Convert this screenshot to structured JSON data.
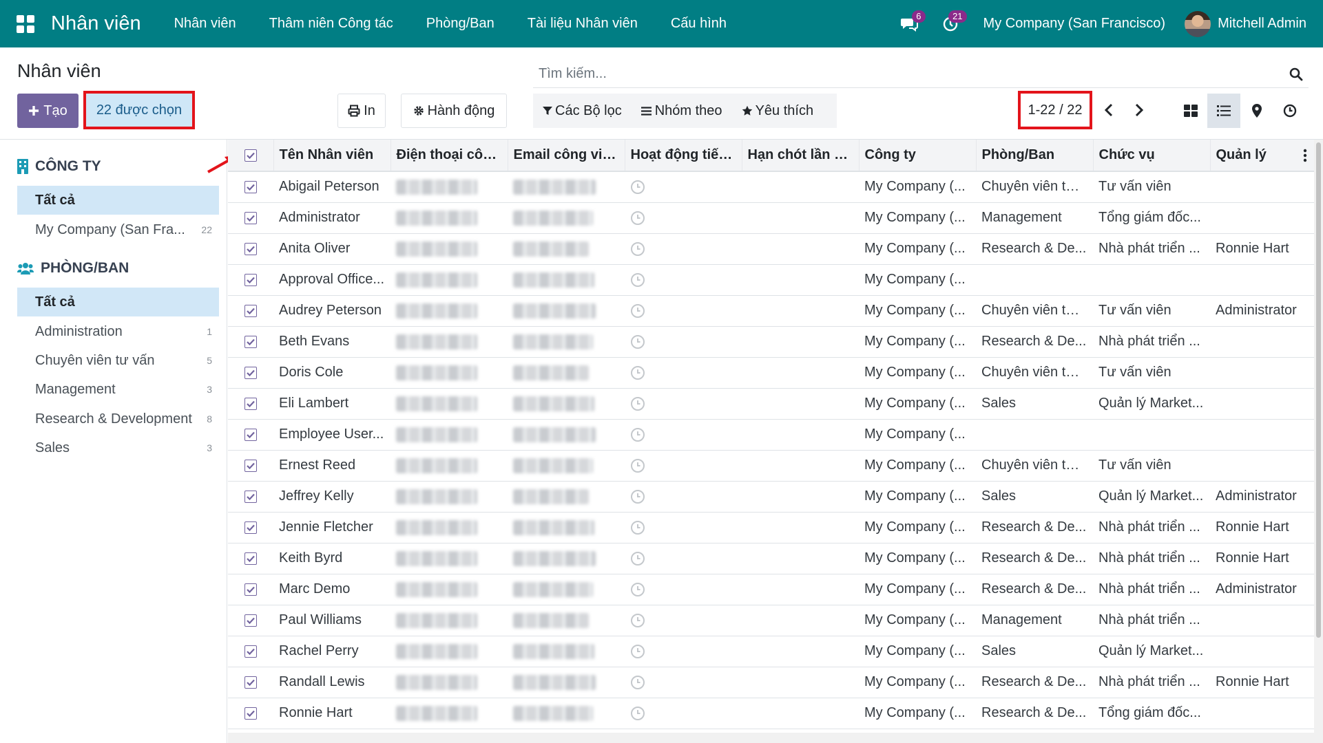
{
  "navbar": {
    "app_name": "Nhân viên",
    "menu": [
      "Nhân viên",
      "Thâm niên Công tác",
      "Phòng/Ban",
      "Tài liệu Nhân viên",
      "Cấu hình"
    ],
    "messages_badge": "6",
    "activities_badge": "21",
    "company": "My Company (San Francisco)",
    "user": "Mitchell Admin"
  },
  "control_panel": {
    "title": "Nhân viên",
    "create_label": "Tạo",
    "selected_label": "22 được chọn",
    "print_label": "In",
    "action_label": "Hành động",
    "search_placeholder": "Tìm kiếm...",
    "filters_label": "Các Bộ lọc",
    "groupby_label": "Nhóm theo",
    "favorites_label": "Yêu thích",
    "pager": "1-22 / 22"
  },
  "side_panel": {
    "company_title": "CÔNG TY",
    "company_items": [
      {
        "label": "Tất cả",
        "count": ""
      },
      {
        "label": "My Company (San Fra...",
        "count": "22"
      }
    ],
    "department_title": "PHÒNG/BAN",
    "department_items": [
      {
        "label": "Tất cả",
        "count": ""
      },
      {
        "label": "Administration",
        "count": "1"
      },
      {
        "label": "Chuyên viên tư vấn",
        "count": "5"
      },
      {
        "label": "Management",
        "count": "3"
      },
      {
        "label": "Research & Development",
        "count": "8"
      },
      {
        "label": "Sales",
        "count": "3"
      }
    ]
  },
  "table": {
    "headers": [
      "Tên Nhân viên",
      "Điện thoại côn...",
      "Email công việ...",
      "Hoạt động tiếp...",
      "Hạn chót lần h...",
      "Công ty",
      "Phòng/Ban",
      "Chức vụ",
      "Quản lý"
    ],
    "rows": [
      {
        "name": "Abigail Peterson",
        "company": "My Company (...",
        "department": "Chuyên viên tư ...",
        "job": "Tư vấn viên",
        "manager": ""
      },
      {
        "name": "Administrator",
        "company": "My Company (...",
        "department": "Management",
        "job": "Tổng giám đốc...",
        "manager": ""
      },
      {
        "name": "Anita Oliver",
        "company": "My Company (...",
        "department": "Research & De...",
        "job": "Nhà phát triển ...",
        "manager": "Ronnie Hart"
      },
      {
        "name": "Approval Office...",
        "company": "My Company (...",
        "department": "",
        "job": "",
        "manager": ""
      },
      {
        "name": "Audrey Peterson",
        "company": "My Company (...",
        "department": "Chuyên viên tư ...",
        "job": "Tư vấn viên",
        "manager": "Administrator"
      },
      {
        "name": "Beth Evans",
        "company": "My Company (...",
        "department": "Research & De...",
        "job": "Nhà phát triển ...",
        "manager": ""
      },
      {
        "name": "Doris Cole",
        "company": "My Company (...",
        "department": "Chuyên viên tư ...",
        "job": "Tư vấn viên",
        "manager": ""
      },
      {
        "name": "Eli Lambert",
        "company": "My Company (...",
        "department": "Sales",
        "job": "Quản lý Market...",
        "manager": ""
      },
      {
        "name": "Employee User...",
        "company": "My Company (...",
        "department": "",
        "job": "",
        "manager": ""
      },
      {
        "name": "Ernest Reed",
        "company": "My Company (...",
        "department": "Chuyên viên tư ...",
        "job": "Tư vấn viên",
        "manager": ""
      },
      {
        "name": "Jeffrey Kelly",
        "company": "My Company (...",
        "department": "Sales",
        "job": "Quản lý Market...",
        "manager": "Administrator"
      },
      {
        "name": "Jennie Fletcher",
        "company": "My Company (...",
        "department": "Research & De...",
        "job": "Nhà phát triển ...",
        "manager": "Ronnie Hart"
      },
      {
        "name": "Keith Byrd",
        "company": "My Company (...",
        "department": "Research & De...",
        "job": "Nhà phát triển ...",
        "manager": "Ronnie Hart"
      },
      {
        "name": "Marc Demo",
        "company": "My Company (...",
        "department": "Research & De...",
        "job": "Nhà phát triển ...",
        "manager": "Administrator"
      },
      {
        "name": "Paul Williams",
        "company": "My Company (...",
        "department": "Management",
        "job": "Nhà phát triển ...",
        "manager": ""
      },
      {
        "name": "Rachel Perry",
        "company": "My Company (...",
        "department": "Sales",
        "job": "Quản lý Market...",
        "manager": ""
      },
      {
        "name": "Randall Lewis",
        "company": "My Company (...",
        "department": "Research & De...",
        "job": "Nhà phát triển ...",
        "manager": "Ronnie Hart"
      },
      {
        "name": "Ronnie Hart",
        "company": "My Company (...",
        "department": "Research & De...",
        "job": "Tổng giám đốc...",
        "manager": ""
      }
    ]
  },
  "colors": {
    "navbar": "#017e84",
    "primary": "#71639e",
    "selection": "#d1e7f7",
    "highlight_border": "#e3141b"
  }
}
